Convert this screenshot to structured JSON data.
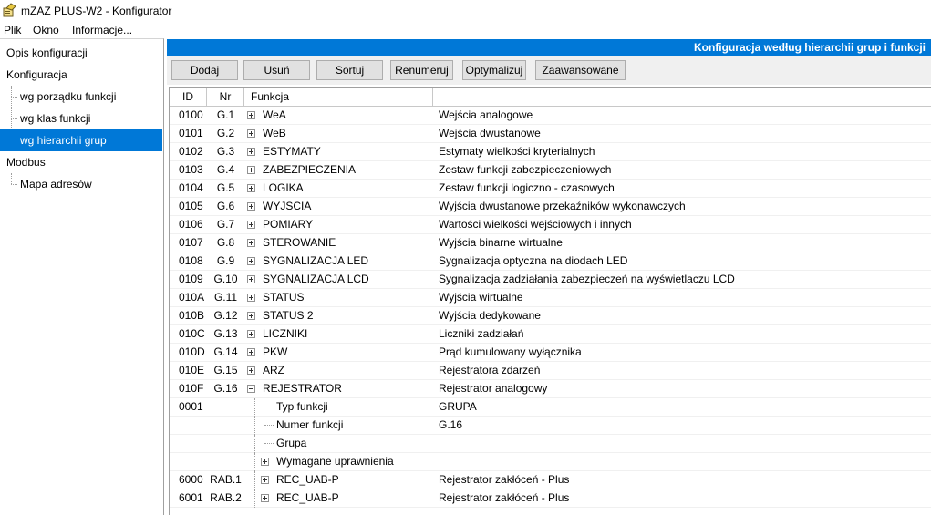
{
  "window": {
    "title": "mZAZ PLUS-W2 - Konfigurator"
  },
  "menu": {
    "items": [
      "Plik",
      "Okno",
      "Informacje..."
    ]
  },
  "sidebar": {
    "items": [
      {
        "label": "Opis konfiguracji",
        "level": 0,
        "selected": false
      },
      {
        "label": "Konfiguracja",
        "level": 0,
        "selected": false
      },
      {
        "label": "wg porządku funkcji",
        "level": 1,
        "selected": false
      },
      {
        "label": "wg klas funkcji",
        "level": 1,
        "selected": false
      },
      {
        "label": "wg hierarchii grup",
        "level": 1,
        "selected": true
      },
      {
        "label": "Modbus",
        "level": 0,
        "selected": false
      },
      {
        "label": "Mapa adresów",
        "level": 1,
        "selected": false
      }
    ]
  },
  "header": {
    "title": "Konfiguracja według hierarchii grup i funkcji"
  },
  "toolbar": {
    "buttons": [
      "Dodaj",
      "Usuń",
      "Sortuj",
      "Renumeruj",
      "Optymalizuj",
      "Zaawansowane"
    ]
  },
  "table": {
    "columns": [
      "ID",
      "Nr",
      "Funkcja",
      ""
    ],
    "rows": [
      {
        "id": "0100",
        "nr": "G.1",
        "func": "WeA",
        "desc": "Wejścia analogowe",
        "expander": "plus",
        "level": 0
      },
      {
        "id": "0101",
        "nr": "G.2",
        "func": "WeB",
        "desc": "Wejścia dwustanowe",
        "expander": "plus",
        "level": 0
      },
      {
        "id": "0102",
        "nr": "G.3",
        "func": "ESTYMATY",
        "desc": "Estymaty wielkości kryterialnych",
        "expander": "plus",
        "level": 0
      },
      {
        "id": "0103",
        "nr": "G.4",
        "func": "ZABEZPIECZENIA",
        "desc": "Zestaw funkcji zabezpieczeniowych",
        "expander": "plus",
        "level": 0
      },
      {
        "id": "0104",
        "nr": "G.5",
        "func": "LOGIKA",
        "desc": "Zestaw funkcji logiczno - czasowych",
        "expander": "plus",
        "level": 0
      },
      {
        "id": "0105",
        "nr": "G.6",
        "func": "WYJSCIA",
        "desc": "Wyjścia dwustanowe przekaźników wykonawczych",
        "expander": "plus",
        "level": 0
      },
      {
        "id": "0106",
        "nr": "G.7",
        "func": "POMIARY",
        "desc": "Wartości wielkości wejściowych i innych",
        "expander": "plus",
        "level": 0
      },
      {
        "id": "0107",
        "nr": "G.8",
        "func": "STEROWANIE",
        "desc": "Wyjścia binarne wirtualne",
        "expander": "plus",
        "level": 0
      },
      {
        "id": "0108",
        "nr": "G.9",
        "func": "SYGNALIZACJA LED",
        "desc": "Sygnalizacja optyczna na diodach LED",
        "expander": "plus",
        "level": 0
      },
      {
        "id": "0109",
        "nr": "G.10",
        "func": "SYGNALIZACJA LCD",
        "desc": "Sygnalizacja zadziałania zabezpieczeń na wyświetlaczu LCD",
        "expander": "plus",
        "level": 0
      },
      {
        "id": "010A",
        "nr": "G.11",
        "func": "STATUS",
        "desc": "Wyjścia wirtualne",
        "expander": "plus",
        "level": 0
      },
      {
        "id": "010B",
        "nr": "G.12",
        "func": "STATUS 2",
        "desc": "Wyjścia dedykowane",
        "expander": "plus",
        "level": 0
      },
      {
        "id": "010C",
        "nr": "G.13",
        "func": "LICZNIKI",
        "desc": "Liczniki zadziałań",
        "expander": "plus",
        "level": 0
      },
      {
        "id": "010D",
        "nr": "G.14",
        "func": "PKW",
        "desc": "Prąd kumulowany wyłącznika",
        "expander": "plus",
        "level": 0
      },
      {
        "id": "010E",
        "nr": "G.15",
        "func": "ARZ",
        "desc": "Rejestratora zdarzeń",
        "expander": "plus",
        "level": 0
      },
      {
        "id": "010F",
        "nr": "G.16",
        "func": "REJESTRATOR",
        "desc": "Rejestrator analogowy",
        "expander": "minus",
        "level": 0
      },
      {
        "id": "0001",
        "nr": "",
        "func": "Typ funkcji",
        "desc": "GRUPA",
        "expander": "none",
        "level": 1
      },
      {
        "id": "",
        "nr": "",
        "func": "Numer funkcji",
        "desc": "G.16",
        "expander": "none",
        "level": 1
      },
      {
        "id": "",
        "nr": "",
        "func": "Grupa",
        "desc": "",
        "expander": "none",
        "level": 1
      },
      {
        "id": "",
        "nr": "",
        "func": "Wymagane uprawnienia",
        "desc": "",
        "expander": "plus",
        "level": 1
      },
      {
        "id": "6000",
        "nr": "RAB.1",
        "func": "REC_UAB-P",
        "desc": "Rejestrator zakłóceń - Plus",
        "expander": "plus",
        "level": 1
      },
      {
        "id": "6001",
        "nr": "RAB.2",
        "func": "REC_UAB-P",
        "desc": "Rejestrator zakłóceń - Plus",
        "expander": "plus",
        "level": 1
      }
    ]
  },
  "colors": {
    "accent": "#0078d7",
    "toolbar_bg": "#f0f0f0",
    "button_bg": "#e1e1e1"
  }
}
